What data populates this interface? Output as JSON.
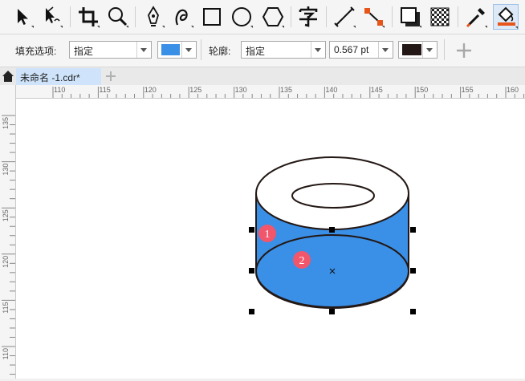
{
  "propbar": {
    "fill_label": "填充选项:",
    "fill_mode": "指定",
    "fill_color": "#3a8fe6",
    "outline_label": "轮廓:",
    "outline_mode": "指定",
    "outline_width": "0.567 pt",
    "outline_color": "#231815"
  },
  "tabs": [
    {
      "label": "未命名 -1.cdr*"
    }
  ],
  "hruler_ticks": [
    "110",
    "115",
    "120",
    "125",
    "130",
    "135",
    "140",
    "145",
    "150",
    "155",
    "160"
  ],
  "vruler_ticks": [
    "135",
    "130",
    "125",
    "120",
    "115",
    "110"
  ],
  "drawing": {
    "fill_color": "#3a8fe6",
    "outline_color": "#231815",
    "markers": [
      {
        "label": "1",
        "color": "#f2566b"
      },
      {
        "label": "2",
        "color": "#f2566b"
      }
    ]
  },
  "icons": [
    "pick-tool-icon",
    "shape-tool-icon",
    "crop-tool-icon",
    "zoom-tool-icon",
    "pen-tool-icon",
    "freehand-tool-icon",
    "rectangle-tool-icon",
    "ellipse-tool-icon",
    "polygon-tool-icon",
    "text-tool-icon",
    "dimension-tool-icon",
    "connector-tool-icon",
    "drop-shadow-tool-icon",
    "transparency-tool-icon",
    "color-eyedropper-icon",
    "interactive-fill-icon",
    "add-preset-icon",
    "home-icon",
    "new-tab-icon"
  ]
}
